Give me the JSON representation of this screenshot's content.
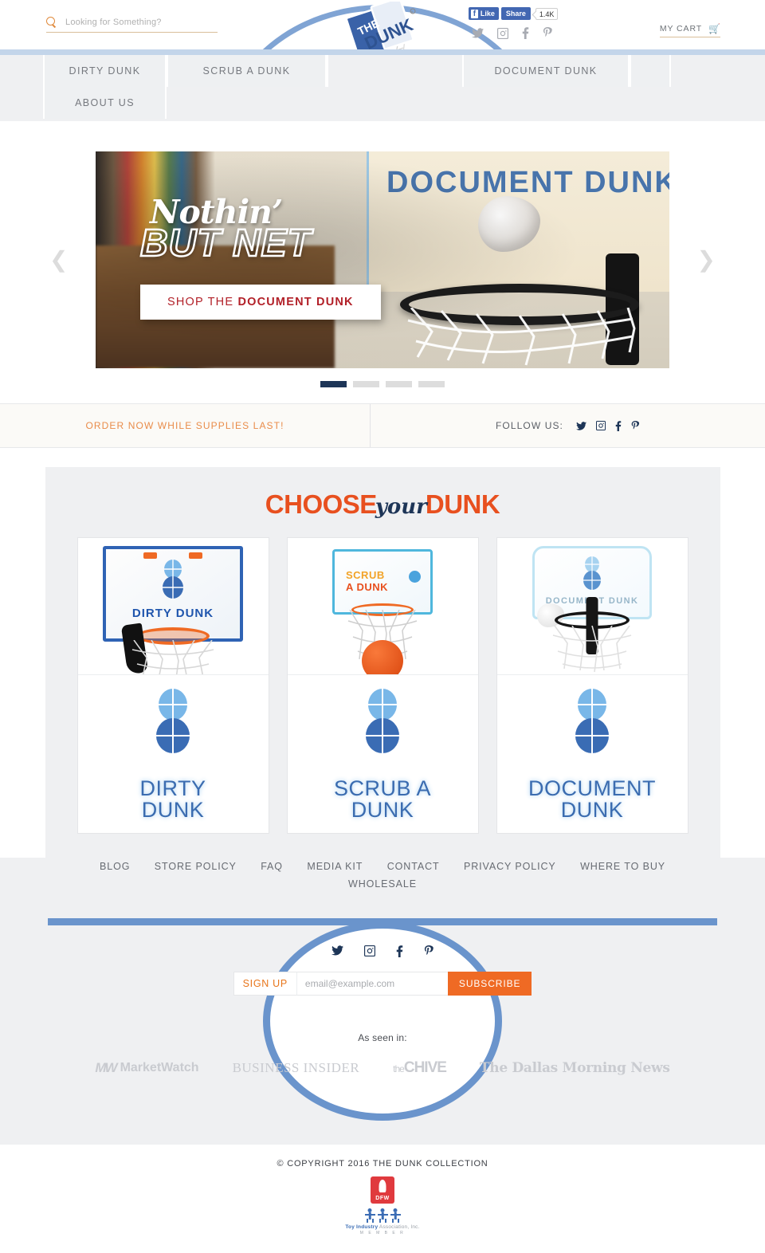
{
  "header": {
    "search": {
      "placeholder": "Looking for Something?",
      "value": "",
      "icon": "search-icon"
    },
    "facebook": {
      "like_label": "Like",
      "share_label": "Share",
      "count": "1.4K"
    },
    "social": [
      {
        "name": "twitter",
        "glyph": "twitter-icon"
      },
      {
        "name": "instagram",
        "glyph": "instagram-icon"
      },
      {
        "name": "facebook",
        "glyph": "facebook-icon"
      },
      {
        "name": "pinterest",
        "glyph": "pinterest-icon"
      }
    ],
    "cart_label": "MY CART",
    "cart_icon": "shopping-cart-icon",
    "logo_alt": "THE DUNK COLLECTION"
  },
  "nav": {
    "items": [
      {
        "label": "DIRTY DUNK"
      },
      {
        "label": "SCRUB A DUNK"
      },
      {
        "label": "DOCUMENT DUNK"
      },
      {
        "label": "ABOUT US"
      }
    ]
  },
  "hero": {
    "script_line": "Nothin’",
    "headline": "BUT NET",
    "cta_prefix": "SHOP THE ",
    "cta_strong": "DOCUMENT DUNK",
    "poster_text": "DOCUMENT DUNK",
    "prev_arrow": "❮",
    "next_arrow": "❯",
    "slides": 4,
    "active_slide": 1
  },
  "promo": {
    "text": "ORDER NOW WHILE SUPPLIES LAST!",
    "follow_label": "FOLLOW US:",
    "social": [
      {
        "name": "twitter"
      },
      {
        "name": "instagram"
      },
      {
        "name": "facebook"
      },
      {
        "name": "pinterest"
      }
    ]
  },
  "choose": {
    "title_part1": "CHOOSE",
    "title_part2": "your",
    "title_part3": "DUNK",
    "cards": [
      {
        "id": "dirty-dunk",
        "line1": "DIRTY",
        "line2": "DUNK",
        "board_text": "DIRTY DUNK"
      },
      {
        "id": "scrub-a-dunk",
        "line1": "SCRUB A",
        "line2": "DUNK",
        "board_text1": "SCRUB",
        "board_text2": "A DUNK"
      },
      {
        "id": "document-dunk",
        "line1": "DOCUMENT",
        "line2": "DUNK",
        "board_text": "DOCUMENT DUNK"
      }
    ]
  },
  "footer_links": [
    {
      "label": "BLOG"
    },
    {
      "label": "STORE POLICY"
    },
    {
      "label": "FAQ"
    },
    {
      "label": "MEDIA KIT"
    },
    {
      "label": "CONTACT"
    },
    {
      "label": "PRIVACY POLICY"
    },
    {
      "label": "WHERE TO BUY"
    },
    {
      "label": "WHOLESALE"
    }
  ],
  "subscribe": {
    "social": [
      {
        "name": "twitter"
      },
      {
        "name": "instagram"
      },
      {
        "name": "facebook"
      },
      {
        "name": "pinterest"
      }
    ],
    "signup_label": "SIGN UP",
    "email_placeholder": "email@example.com",
    "email_value": "",
    "button_label": "SUBSCRIBE"
  },
  "press": {
    "label": "As seen in:",
    "logos": [
      {
        "name": "marketwatch",
        "mark": "MW",
        "text": "MarketWatch"
      },
      {
        "name": "business-insider",
        "text": "BUSINESS INSIDER"
      },
      {
        "name": "thechive",
        "the": "the",
        "text": "CHIVE"
      },
      {
        "name": "dallas-morning-news",
        "text": "The Dallas Morning News"
      }
    ]
  },
  "bottom": {
    "copyright": "© COPYRIGHT 2016 THE DUNK COLLECTION",
    "dfw_badge": "DFW",
    "tia_text_bold": "Toy Industry",
    "tia_text_rest": " Association, Inc.",
    "tia_member": "M E M B E R"
  },
  "colors": {
    "orange": "#ef6a24",
    "navy": "#1d3557",
    "blue": "#6a94cc",
    "gray_bg": "#eff0f2",
    "red": "#b22028"
  }
}
